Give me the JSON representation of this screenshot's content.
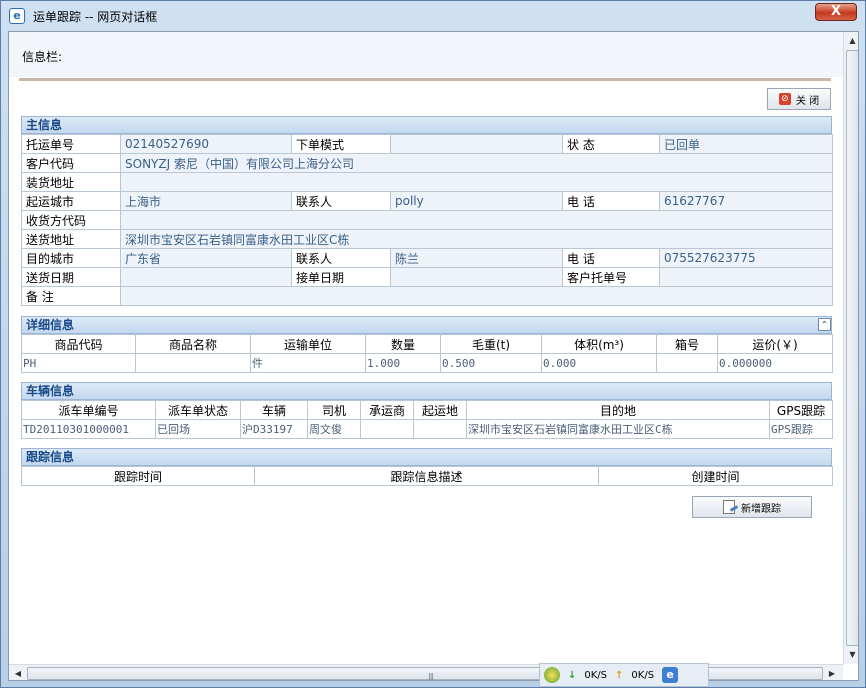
{
  "window": {
    "title": "运单跟踪 -- 网页对话框",
    "close_glyph": "X"
  },
  "infobar": {
    "label": "信息栏:"
  },
  "close_button": {
    "label": "关 闭"
  },
  "main_info": {
    "heading": "主信息",
    "rows": [
      {
        "l1": "托运单号",
        "v1": "02140527690",
        "l2": "下单模式",
        "v2": "",
        "l3": "状  态",
        "v3": "已回单"
      },
      {
        "l1": "客户代码",
        "v1": "SONYZJ 索尼（中国）有限公司上海分公司"
      },
      {
        "l1": "装货地址",
        "v1": ""
      },
      {
        "l1": "起运城市",
        "v1": "上海市",
        "l2": "联系人",
        "v2": "polly",
        "l3": "电  话",
        "v3": "61627767"
      },
      {
        "l1": "收货方代码",
        "v1": ""
      },
      {
        "l1": "送货地址",
        "v1": "深圳市宝安区石岩镇同富康水田工业区C栋"
      },
      {
        "l1": "目的城市",
        "v1": "广东省",
        "l2": "联系人",
        "v2": "陈兰",
        "l3": "电  话",
        "v3": "075527623775"
      },
      {
        "l1": "送货日期",
        "v1": "",
        "l2": "接单日期",
        "v2": "",
        "l3": "客户托单号",
        "v3": ""
      },
      {
        "l1": "备  注",
        "v1": ""
      }
    ]
  },
  "detail_info": {
    "heading": "详细信息",
    "collapse_glyph": "⌃",
    "columns": [
      "商品代码",
      "商品名称",
      "运输单位",
      "数量",
      "毛重(t)",
      "体积(m³)",
      "箱号",
      "运价(￥)"
    ],
    "rows": [
      [
        "PH",
        "",
        "件",
        "1.000",
        "0.500",
        "0.000",
        "",
        "0.000000"
      ]
    ]
  },
  "vehicle_info": {
    "heading": "车辆信息",
    "columns": [
      "派车单编号",
      "派车单状态",
      "车辆",
      "司机",
      "承运商",
      "起运地",
      "目的地",
      "GPS跟踪"
    ],
    "rows": [
      [
        "TD20110301000001",
        "已回场",
        "沪D33197",
        "周文俊",
        "",
        "",
        "深圳市宝安区石岩镇同富康水田工业区C栋",
        "GPS跟踪"
      ]
    ]
  },
  "tracking_info": {
    "heading": "跟踪信息",
    "columns": [
      "跟踪时间",
      "跟踪信息描述",
      "创建时间"
    ]
  },
  "add_tracking_button": {
    "label": "新增跟踪"
  },
  "statusbar": {
    "down_rate": "0K/S",
    "up_rate": "0K/S"
  }
}
